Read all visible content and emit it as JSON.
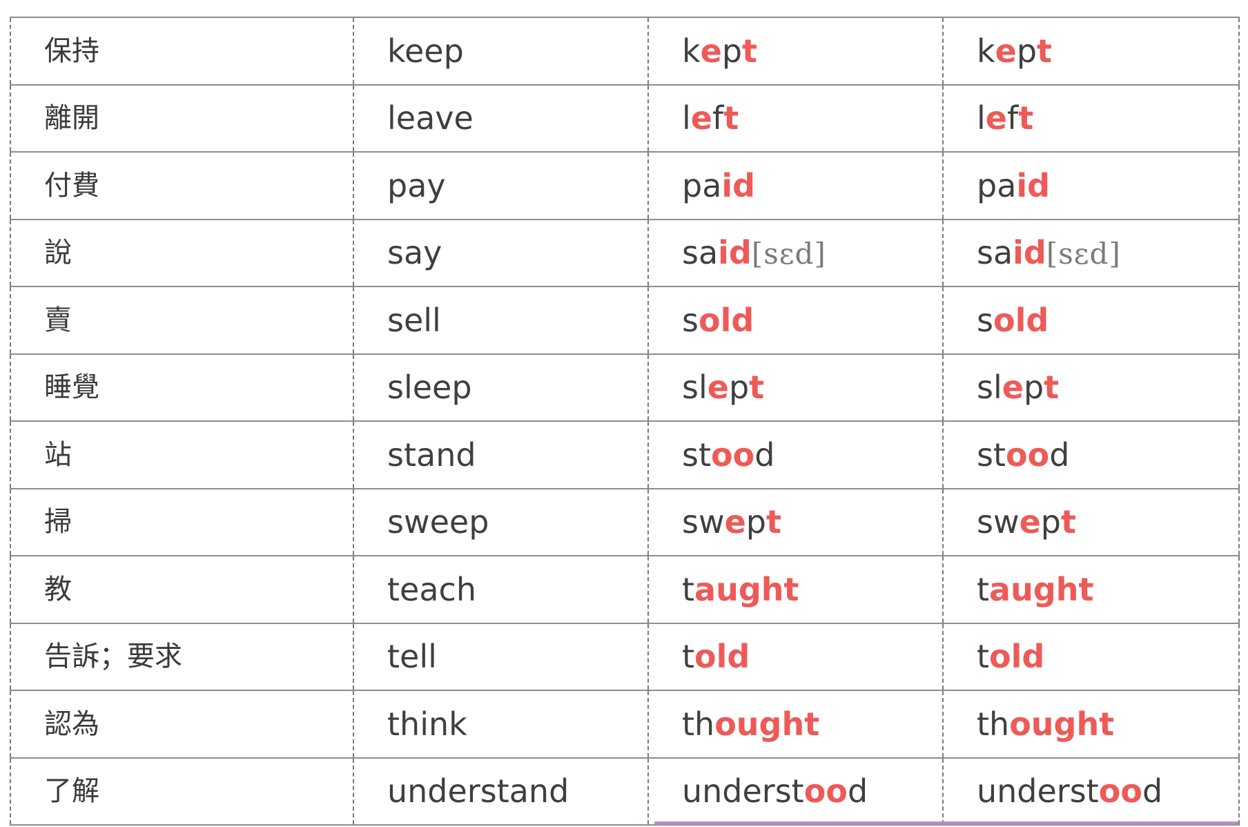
{
  "rows": [
    {
      "zh": "保持",
      "base": "keep",
      "past": [
        [
          "k",
          false
        ],
        [
          "e",
          true
        ],
        [
          "p",
          false
        ],
        [
          "t",
          true
        ]
      ],
      "pp": [
        [
          "k",
          false
        ],
        [
          "e",
          true
        ],
        [
          "p",
          false
        ],
        [
          "t",
          true
        ]
      ]
    },
    {
      "zh": "離開",
      "base": "leave",
      "past": [
        [
          "l",
          false
        ],
        [
          "e",
          true
        ],
        [
          "f",
          false
        ],
        [
          "t",
          true
        ]
      ],
      "pp": [
        [
          "l",
          false
        ],
        [
          "e",
          true
        ],
        [
          "f",
          false
        ],
        [
          "t",
          true
        ]
      ]
    },
    {
      "zh": "付費",
      "base": "pay",
      "past": [
        [
          "pa",
          false
        ],
        [
          "id",
          true
        ]
      ],
      "pp": [
        [
          "pa",
          false
        ],
        [
          "id",
          true
        ]
      ]
    },
    {
      "zh": "說",
      "base": "say",
      "past": [
        [
          "sa",
          false
        ],
        [
          "id",
          true
        ]
      ],
      "pp": [
        [
          "sa",
          false
        ],
        [
          "id",
          true
        ]
      ],
      "phonetic": "[sɛd]"
    },
    {
      "zh": "賣",
      "base": "sell",
      "past": [
        [
          "s",
          false
        ],
        [
          "old",
          true
        ]
      ],
      "pp": [
        [
          "s",
          false
        ],
        [
          "old",
          true
        ]
      ]
    },
    {
      "zh": "睡覺",
      "base": "sleep",
      "past": [
        [
          "sl",
          false
        ],
        [
          "e",
          true
        ],
        [
          "p",
          false
        ],
        [
          "t",
          true
        ]
      ],
      "pp": [
        [
          "sl",
          false
        ],
        [
          "e",
          true
        ],
        [
          "p",
          false
        ],
        [
          "t",
          true
        ]
      ]
    },
    {
      "zh": "站",
      "base": "stand",
      "past": [
        [
          "st",
          false
        ],
        [
          "oo",
          true
        ],
        [
          "d",
          false
        ]
      ],
      "pp": [
        [
          "st",
          false
        ],
        [
          "oo",
          true
        ],
        [
          "d",
          false
        ]
      ]
    },
    {
      "zh": "掃",
      "base": "sweep",
      "past": [
        [
          "sw",
          false
        ],
        [
          "e",
          true
        ],
        [
          "p",
          false
        ],
        [
          "t",
          true
        ]
      ],
      "pp": [
        [
          "sw",
          false
        ],
        [
          "e",
          true
        ],
        [
          "p",
          false
        ],
        [
          "t",
          true
        ]
      ]
    },
    {
      "zh": "教",
      "base": "teach",
      "past": [
        [
          "t",
          false
        ],
        [
          "aught",
          true
        ]
      ],
      "pp": [
        [
          "t",
          false
        ],
        [
          "aught",
          true
        ]
      ]
    },
    {
      "zh": "告訴；要求",
      "base": "tell",
      "past": [
        [
          "t",
          false
        ],
        [
          "old",
          true
        ]
      ],
      "pp": [
        [
          "t",
          false
        ],
        [
          "old",
          true
        ]
      ]
    },
    {
      "zh": "認為",
      "base": "think",
      "past": [
        [
          "th",
          false
        ],
        [
          "ought",
          true
        ]
      ],
      "pp": [
        [
          "th",
          false
        ],
        [
          "ought",
          true
        ]
      ]
    },
    {
      "zh": "了解",
      "base": "understand",
      "past": [
        [
          "underst",
          false
        ],
        [
          "oo",
          true
        ],
        [
          "d",
          false
        ]
      ],
      "pp": [
        [
          "underst",
          false
        ],
        [
          "oo",
          true
        ],
        [
          "d",
          false
        ]
      ]
    }
  ],
  "colors": {
    "text": "#3f3f3f",
    "highlight": "#ee5a57",
    "phonetic": "#7a7a7a",
    "accent_bar": "#b48fc2"
  }
}
